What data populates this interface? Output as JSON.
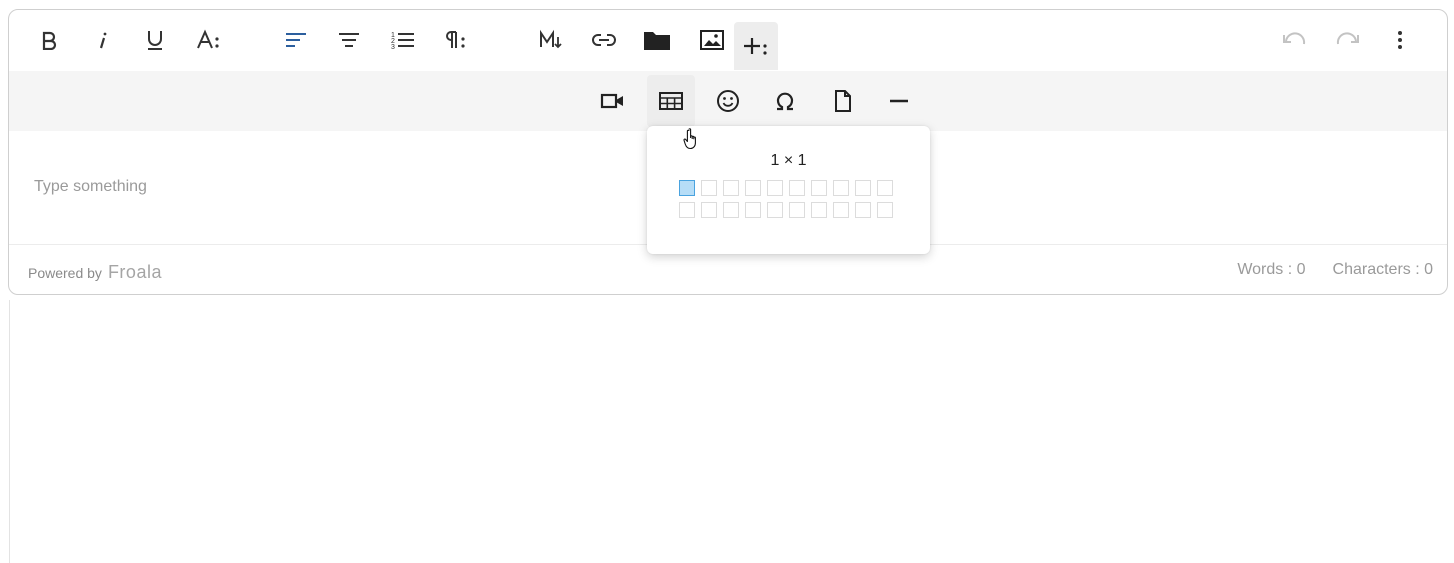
{
  "toolbar": {
    "buttons": [
      {
        "name": "bold-button",
        "icon": "bold-icon",
        "glyph": "B"
      },
      {
        "name": "italic-button",
        "icon": "italic-icon",
        "glyph": "i"
      },
      {
        "name": "underline-button",
        "icon": "underline-icon",
        "glyph": "U"
      },
      {
        "name": "more-text-button",
        "icon": "text-size-icon",
        "glyph": "A"
      },
      {
        "name": "align-left-button",
        "icon": "align-left-icon"
      },
      {
        "name": "align-center-button",
        "icon": "align-center-icon"
      },
      {
        "name": "ordered-list-button",
        "icon": "ordered-list-icon"
      },
      {
        "name": "more-paragraph-button",
        "icon": "paragraph-icon",
        "glyph": "¶"
      },
      {
        "name": "markdown-button",
        "icon": "markdown-icon",
        "glyph": "M"
      },
      {
        "name": "insert-link-button",
        "icon": "link-icon"
      },
      {
        "name": "insert-file-button",
        "icon": "folder-icon"
      },
      {
        "name": "insert-image-button",
        "icon": "image-icon"
      },
      {
        "name": "more-rich-button",
        "icon": "plus-icon",
        "glyph": "+"
      }
    ],
    "undo_icon": "undo-icon",
    "redo_icon": "redo-icon",
    "more_icon": "more-vertical-icon"
  },
  "more_toolbar": {
    "buttons": [
      {
        "name": "insert-video-button",
        "icon": "video-icon"
      },
      {
        "name": "insert-table-button",
        "icon": "table-icon"
      },
      {
        "name": "emoticons-button",
        "icon": "smiley-icon"
      },
      {
        "name": "special-characters-button",
        "icon": "omega-icon",
        "glyph": "Ω"
      },
      {
        "name": "insert-document-button",
        "icon": "file-icon"
      },
      {
        "name": "horizontal-line-button",
        "icon": "horizontal-line-icon"
      }
    ]
  },
  "content": {
    "placeholder": "Type something"
  },
  "footer": {
    "powered_by": "Powered by",
    "brand": "Froala",
    "words": "Words : 0",
    "characters": "Characters : 0"
  },
  "table_popup": {
    "size_label": "1 × 1",
    "rows": 2,
    "cols": 10,
    "selected_rows": 1,
    "selected_cols": 1
  },
  "colors": {
    "accent": "#1e88e5",
    "selected_cell": "#b6ddf7",
    "toolbar_bg": "#f5f5f5"
  }
}
